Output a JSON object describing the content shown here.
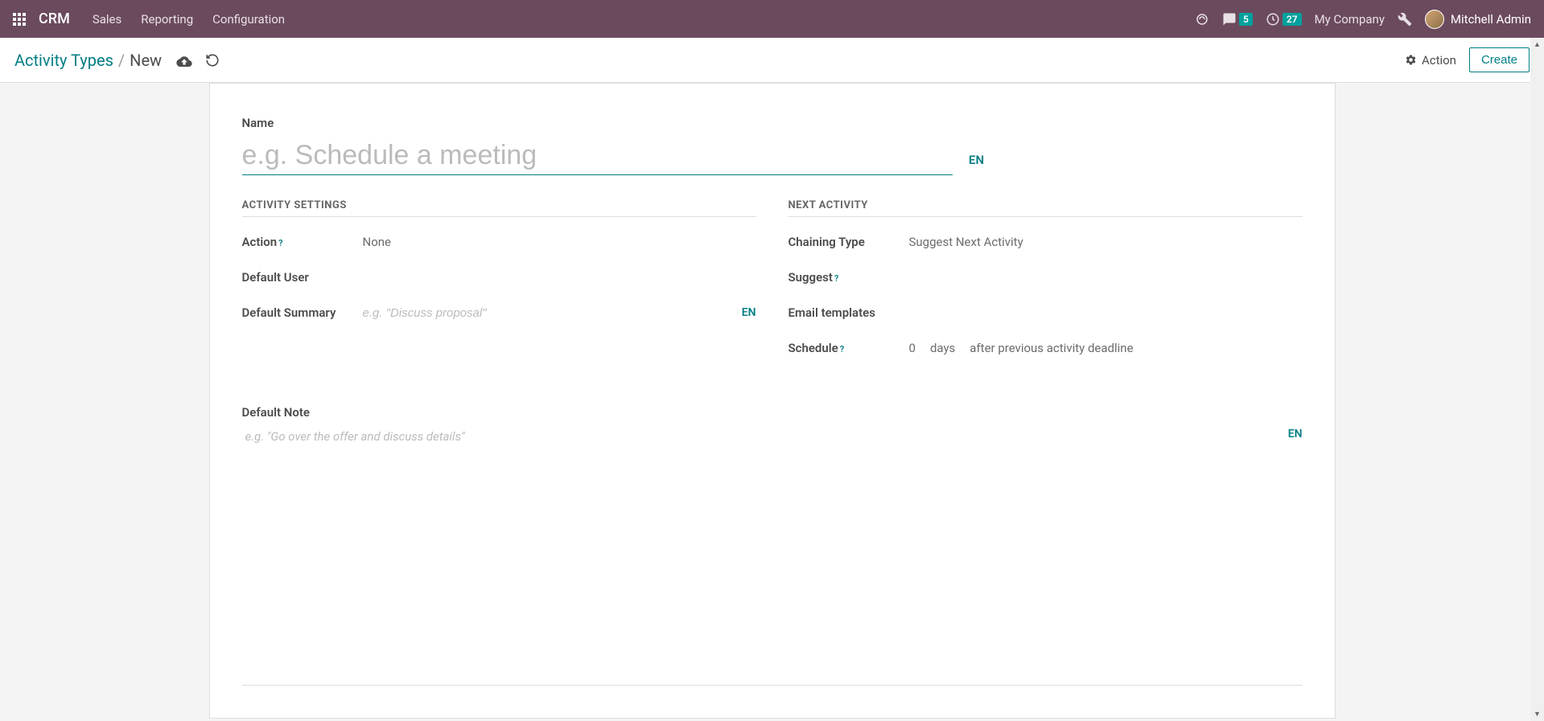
{
  "nav": {
    "brand": "CRM",
    "items": [
      "Sales",
      "Reporting",
      "Configuration"
    ],
    "messages_badge": "5",
    "activities_badge": "27",
    "company": "My Company",
    "user": "Mitchell Admin"
  },
  "breadcrumb": {
    "parent": "Activity Types",
    "current": "New"
  },
  "header_buttons": {
    "action": "Action",
    "create": "Create"
  },
  "form": {
    "name_label": "Name",
    "name_placeholder": "e.g. Schedule a meeting",
    "name_lang": "EN",
    "section_activity": "ACTIVITY SETTINGS",
    "section_next": "NEXT ACTIVITY",
    "action_label": "Action",
    "action_value": "None",
    "default_user_label": "Default User",
    "default_summary_label": "Default Summary",
    "default_summary_placeholder": "e.g. \"Discuss proposal\"",
    "summary_lang": "EN",
    "chaining_label": "Chaining Type",
    "chaining_value": "Suggest Next Activity",
    "suggest_label": "Suggest",
    "email_templates_label": "Email templates",
    "schedule_label": "Schedule",
    "schedule_count": "0",
    "schedule_unit": "days",
    "schedule_after": "after previous activity deadline",
    "note_label": "Default Note",
    "note_placeholder": "e.g. \"Go over the offer and discuss details\"",
    "note_lang": "EN"
  }
}
